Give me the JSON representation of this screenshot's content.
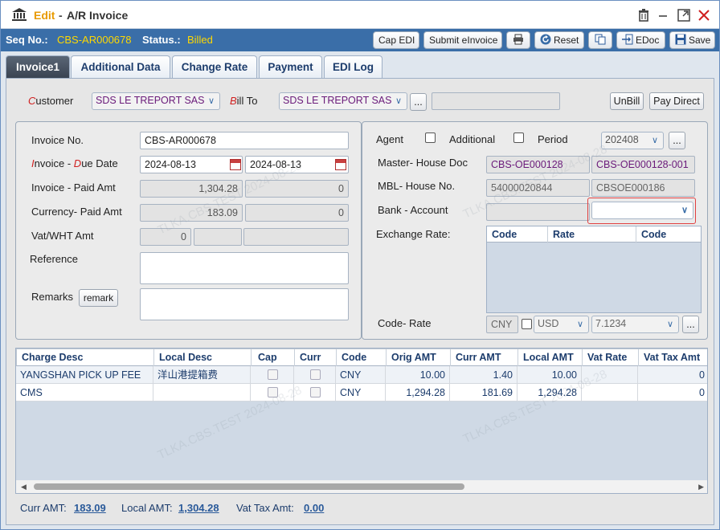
{
  "title": {
    "edit": "Edit",
    "separator": "-",
    "name": "A/R Invoice"
  },
  "status_bar": {
    "seq_label": "Seq No.:",
    "seq_value": "CBS-AR000678",
    "status_label": "Status.:",
    "status_value": "Billed"
  },
  "toolbar": {
    "cap_edi": "Cap EDI",
    "submit_einvoice": "Submit eInvoice",
    "reset": "Reset",
    "edoc": "EDoc",
    "save": "Save"
  },
  "tabs": [
    "Invoice1",
    "Additional Data",
    "Change Rate",
    "Payment",
    "EDI Log"
  ],
  "customer": {
    "label": "ustomer",
    "label_initial": "C",
    "value": "SDS LE TREPORT SAS",
    "bill_to_label": "ill To",
    "bill_to_initial": "B",
    "bill_to_value": "SDS LE TREPORT SAS",
    "more": "...",
    "unbill": "UnBill",
    "pay_direct": "Pay Direct"
  },
  "left": {
    "invoice_no_label": "Invoice No.",
    "invoice_no": "CBS-AR000678",
    "invoice_date_label_1": "nvoice",
    "invoice_date_initial": "I",
    "due_date_label": "ue Date",
    "due_date_initial": "D",
    "dash": "-",
    "invoice_date": "2024-08-13",
    "due_date": "2024-08-13",
    "paid_amt_label_1": "Invoice",
    "paid_amt_label_2": "Paid Amt",
    "invoice_amt": "1,304.28",
    "paid_amt": "0",
    "currency_label": "Currency-",
    "currency_paid_label": "Paid Amt",
    "currency_amt": "183.09",
    "currency_paid": "0",
    "vat_label": "Vat/WHT Amt",
    "vat_amt": "0",
    "reference_label": "Reference",
    "remarks_label": "Remarks",
    "remark_button": "remark"
  },
  "right": {
    "agent_label": "Agent",
    "additional_label": "Additional",
    "period_label": "Period",
    "period_value": "202408",
    "more": "...",
    "master_label": "Master-",
    "house_doc_label": "House Doc",
    "master_doc": "CBS-OE000128",
    "house_doc": "CBS-OE000128-001",
    "mbl_label": "MBL-",
    "house_no_label": "House No.",
    "mbl_no": "54000020844",
    "house_no": "CBSOE000186",
    "bank_label": "Bank -",
    "account_label": "Account",
    "exchange_rate_label": "Exchange Rate:",
    "rate_cols": [
      "Code",
      "Rate",
      "Code"
    ],
    "code_rate_label": "Code- Rate",
    "code_value": "CNY",
    "usd_value": "USD",
    "rate_value": "7.1234"
  },
  "charges": {
    "columns": [
      "Charge Desc",
      "Local Desc",
      "Cap",
      "Curr",
      "Code",
      "Orig AMT",
      "Curr AMT",
      "Local AMT",
      "Vat Rate",
      "Vat Tax Amt"
    ],
    "rows": [
      {
        "desc": "YANGSHAN PICK UP FEE",
        "local": "洋山港提箱费",
        "code": "CNY",
        "orig": "10.00",
        "curr": "1.40",
        "localamt": "10.00",
        "vatrate": "",
        "vattax": "0"
      },
      {
        "desc": "CMS",
        "local": "",
        "code": "CNY",
        "orig": "1,294.28",
        "curr": "181.69",
        "localamt": "1,294.28",
        "vatrate": "",
        "vattax": "0"
      }
    ]
  },
  "footer": {
    "curr_amt_label": "Curr AMT:",
    "curr_amt": "183.09",
    "local_amt_label": "Local AMT:",
    "local_amt": "1,304.28",
    "vat_label": "Vat Tax Amt:",
    "vat_amt": "0.00"
  },
  "watermark": "TLKA.CBS.TEST 2024-08-28",
  "colors": {
    "accent": "#3a6ea8",
    "status_value": "#ffd800",
    "edit": "#e89a00",
    "highlight_border": "#e04040"
  }
}
